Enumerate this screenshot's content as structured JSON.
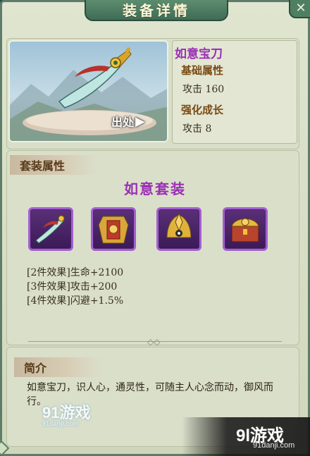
{
  "window": {
    "title": "装备详情"
  },
  "item": {
    "name": "如意宝刀",
    "origin_label": "出处",
    "base_attr_label": "基础属性",
    "base_attr_value": "攻击 160",
    "growth_label": "强化成长",
    "growth_value": "攻击 8"
  },
  "set": {
    "section_label": "套装属性",
    "name": "如意套装",
    "pieces": [
      {
        "icon": "sword-icon"
      },
      {
        "icon": "armor-icon"
      },
      {
        "icon": "helmet-icon"
      },
      {
        "icon": "treasure-chest-icon"
      }
    ],
    "bonuses": [
      "[2件效果]生命+2100",
      "[3件效果]攻击+200",
      "[4件效果]闪避+1.5%"
    ]
  },
  "intro": {
    "section_label": "简介",
    "text": "如意宝刀，识人心，通灵性，可随主人心念而动，御风而行。"
  },
  "watermark": {
    "left_logo": "91游戏",
    "left_url": "91danji.com",
    "right_logo": "9l游戏",
    "right_url": "91danji.com"
  },
  "colors": {
    "accent_purple": "#9a2fb4",
    "frame_green": "#3f6c55",
    "label_brown": "#7a4a12"
  }
}
